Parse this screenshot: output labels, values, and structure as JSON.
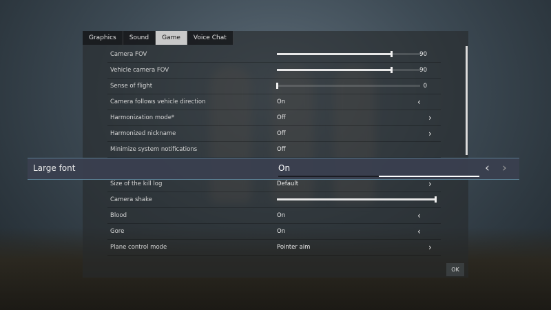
{
  "tabs": [
    {
      "label": "Graphics",
      "active": false
    },
    {
      "label": "Sound",
      "active": false
    },
    {
      "label": "Game",
      "active": true
    },
    {
      "label": "Voice Chat",
      "active": false
    }
  ],
  "settings": [
    {
      "label": "Camera FOV",
      "value": "90",
      "slider": 0.8
    },
    {
      "label": "Vehicle camera FOV",
      "value": "90",
      "slider": 0.8
    },
    {
      "label": "Sense of flight",
      "value": "0",
      "slider": 0.0
    },
    {
      "label": "Camera follows vehicle direction",
      "value": "On",
      "arrow": "left"
    },
    {
      "label": "Harmonization mode*",
      "value": "Off",
      "arrow": "right"
    },
    {
      "label": "Harmonized nickname",
      "value": "Off",
      "arrow": "right"
    },
    {
      "label": "Minimize system notifications",
      "value": "Off"
    },
    {
      "label": "",
      "value": ""
    },
    {
      "label": "Size of the kill log",
      "value": "Default",
      "arrow": "right"
    },
    {
      "label": "Camera shake",
      "value": "",
      "slider": 1.0
    },
    {
      "label": "Blood",
      "value": "On",
      "arrow": "left"
    },
    {
      "label": "Gore",
      "value": "On",
      "arrow": "left"
    },
    {
      "label": "Plane control mode",
      "value": "Pointer aim",
      "arrow": "right"
    }
  ],
  "focused": {
    "label": "Large font",
    "value": "On",
    "fill_start": 0.5,
    "fill_end": 1.0
  },
  "ok_label": "OK",
  "colors": {
    "accent": "#5a7e92",
    "focus_bg": "#3a3f4e"
  }
}
